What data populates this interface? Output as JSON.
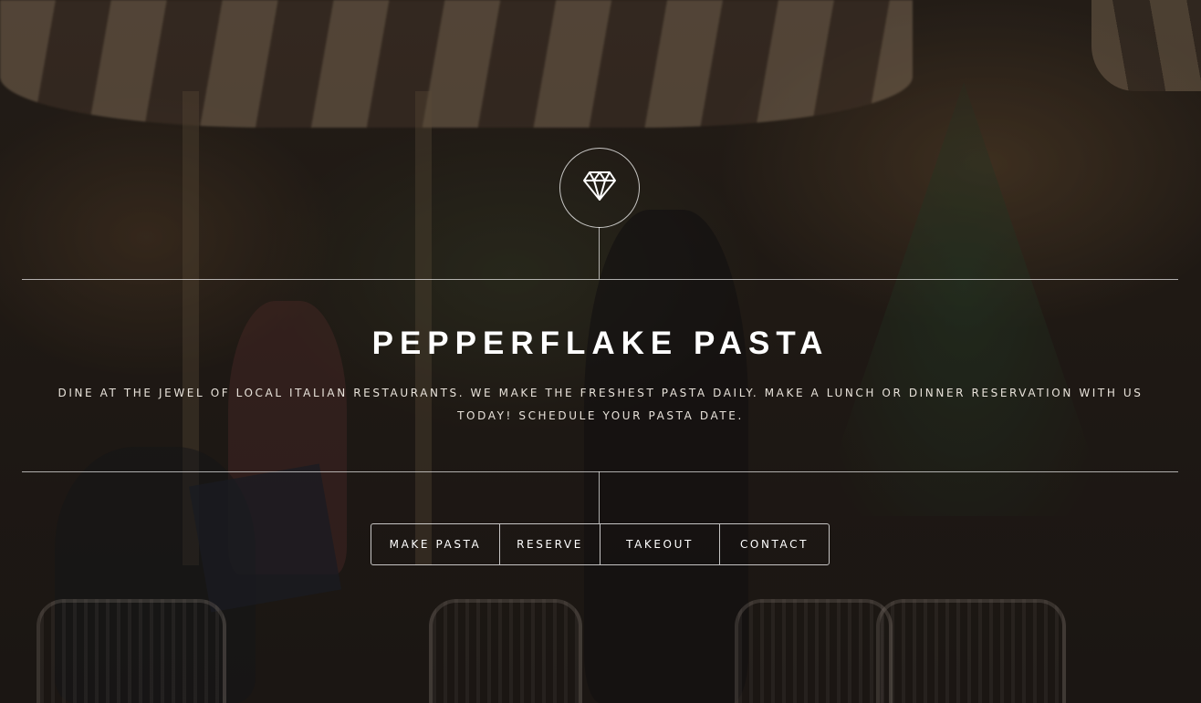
{
  "brand": {
    "title": "PEPPERFLAKE PASTA",
    "tagline": "DINE AT THE JEWEL OF LOCAL ITALIAN RESTAURANTS. WE MAKE THE FRESHEST PASTA DAILY. MAKE A LUNCH OR DINNER RESERVATION WITH US TODAY! SCHEDULE YOUR PASTA DATE.",
    "emblem_icon": "diamond-icon"
  },
  "nav": {
    "items": [
      {
        "label": "MAKE PASTA"
      },
      {
        "label": "RESERVE"
      },
      {
        "label": "TAKEOUT"
      },
      {
        "label": "CONTACT"
      }
    ]
  },
  "colors": {
    "text": "#ffffff",
    "rule": "#ffffff",
    "backdrop": "#1f1b18"
  }
}
